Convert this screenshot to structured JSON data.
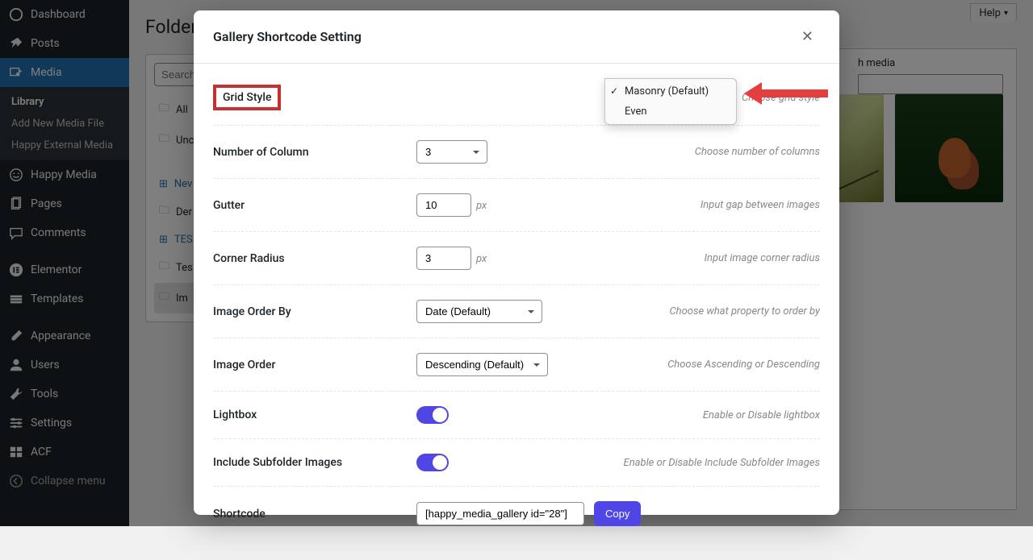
{
  "sidebar": {
    "items": [
      {
        "label": "Dashboard",
        "icon": "dashboard"
      },
      {
        "label": "Posts",
        "icon": "pin"
      },
      {
        "label": "Media",
        "icon": "media",
        "active": true
      },
      {
        "label": "Happy Media",
        "icon": "smile"
      },
      {
        "label": "Pages",
        "icon": "page"
      },
      {
        "label": "Comments",
        "icon": "comment"
      },
      {
        "label": "Elementor",
        "icon": "elementor"
      },
      {
        "label": "Templates",
        "icon": "templates"
      },
      {
        "label": "Appearance",
        "icon": "brush"
      },
      {
        "label": "Users",
        "icon": "user"
      },
      {
        "label": "Tools",
        "icon": "wrench"
      },
      {
        "label": "Settings",
        "icon": "settings"
      },
      {
        "label": "ACF",
        "icon": "acf"
      },
      {
        "label": "Collapse menu",
        "icon": "collapse"
      }
    ],
    "submenu": [
      {
        "label": "Library",
        "active": true
      },
      {
        "label": "Add New Media File"
      },
      {
        "label": "Happy External Media"
      }
    ]
  },
  "header": {
    "help": "Help",
    "page_title": "Folder"
  },
  "folders": {
    "search_placeholder": "Search",
    "items": [
      {
        "label": "All",
        "type": "folder"
      },
      {
        "label": "Unc",
        "type": "folder"
      },
      {
        "label": "Nev",
        "type": "new"
      },
      {
        "label": "Der",
        "type": "folder"
      },
      {
        "label": "TES",
        "type": "new"
      },
      {
        "label": "Tes",
        "type": "folder"
      },
      {
        "label": "Im",
        "type": "folder",
        "selected": true
      }
    ]
  },
  "media": {
    "search_label": "h media",
    "search_value": ""
  },
  "modal": {
    "title": "Gallery Shortcode Setting",
    "rows": {
      "grid_style": {
        "label": "Grid Style",
        "hint": "Choose grid style",
        "options": [
          "Masonry (Default)",
          "Even"
        ],
        "selected": "Masonry (Default)"
      },
      "num_col": {
        "label": "Number of Column",
        "value": "3",
        "hint": "Choose number of columns"
      },
      "gutter": {
        "label": "Gutter",
        "value": "10",
        "unit": "px",
        "hint": "Input gap between images"
      },
      "corner": {
        "label": "Corner Radius",
        "value": "3",
        "unit": "px",
        "hint": "Input image corner radius"
      },
      "order_by": {
        "label": "Image Order By",
        "value": "Date (Default)",
        "hint": "Choose what property to order by"
      },
      "order": {
        "label": "Image Order",
        "value": "Descending (Default)",
        "hint": "Choose Ascending or Descending"
      },
      "lightbox": {
        "label": "Lightbox",
        "hint": "Enable or Disable lightbox"
      },
      "subfolder": {
        "label": "Include Subfolder Images",
        "hint": "Enable or Disable Include Subfolder Images"
      },
      "shortcode": {
        "label": "Shortcode",
        "value": "[happy_media_gallery id=\"28\"]",
        "button": "Copy"
      }
    }
  }
}
